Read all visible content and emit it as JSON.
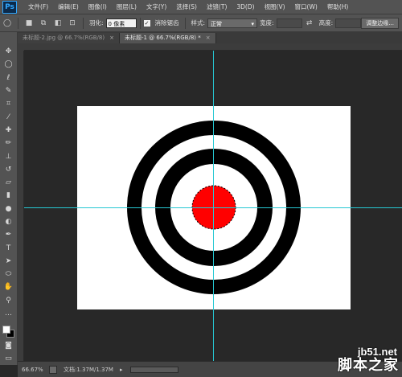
{
  "app": {
    "logo": "Ps"
  },
  "menu": {
    "items": [
      "文件(F)",
      "编辑(E)",
      "图像(I)",
      "图层(L)",
      "文字(Y)",
      "选择(S)",
      "滤镜(T)",
      "3D(D)",
      "视图(V)",
      "窗口(W)",
      "帮助(H)"
    ]
  },
  "options": {
    "feather_label": "羽化:",
    "feather_value": "0 像素",
    "antialias_label": "消除锯齿",
    "antialias_checked": true,
    "style_label": "样式:",
    "style_value": "正常",
    "width_label": "宽度:",
    "height_label": "高度:",
    "refine_edge_button": "调整边缘..."
  },
  "tabs": [
    {
      "label": "未标题-2.jpg @ 66.7%(RGB/8)",
      "active": false
    },
    {
      "label": "未标题-1 @ 66.7%(RGB/8) *",
      "active": true
    }
  ],
  "tools": [
    "move-icon",
    "marquee-icon",
    "lasso-icon",
    "quick-select-icon",
    "crop-icon",
    "eyedropper-icon",
    "healing-icon",
    "brush-icon",
    "stamp-icon",
    "history-brush-icon",
    "eraser-icon",
    "gradient-icon",
    "blur-icon",
    "dodge-icon",
    "pen-icon",
    "type-icon",
    "path-select-icon",
    "shape-icon",
    "hand-icon",
    "zoom-icon"
  ],
  "canvas": {
    "ring_color": "#000000",
    "background_color": "#ffffff",
    "center_color": "#ff0000",
    "guide_color": "#27c8d3"
  },
  "status": {
    "zoom": "66.67%",
    "doc_info": "文档:1.37M/1.37M"
  },
  "watermark": {
    "url": "jb51.net",
    "name": "脚本之家"
  }
}
